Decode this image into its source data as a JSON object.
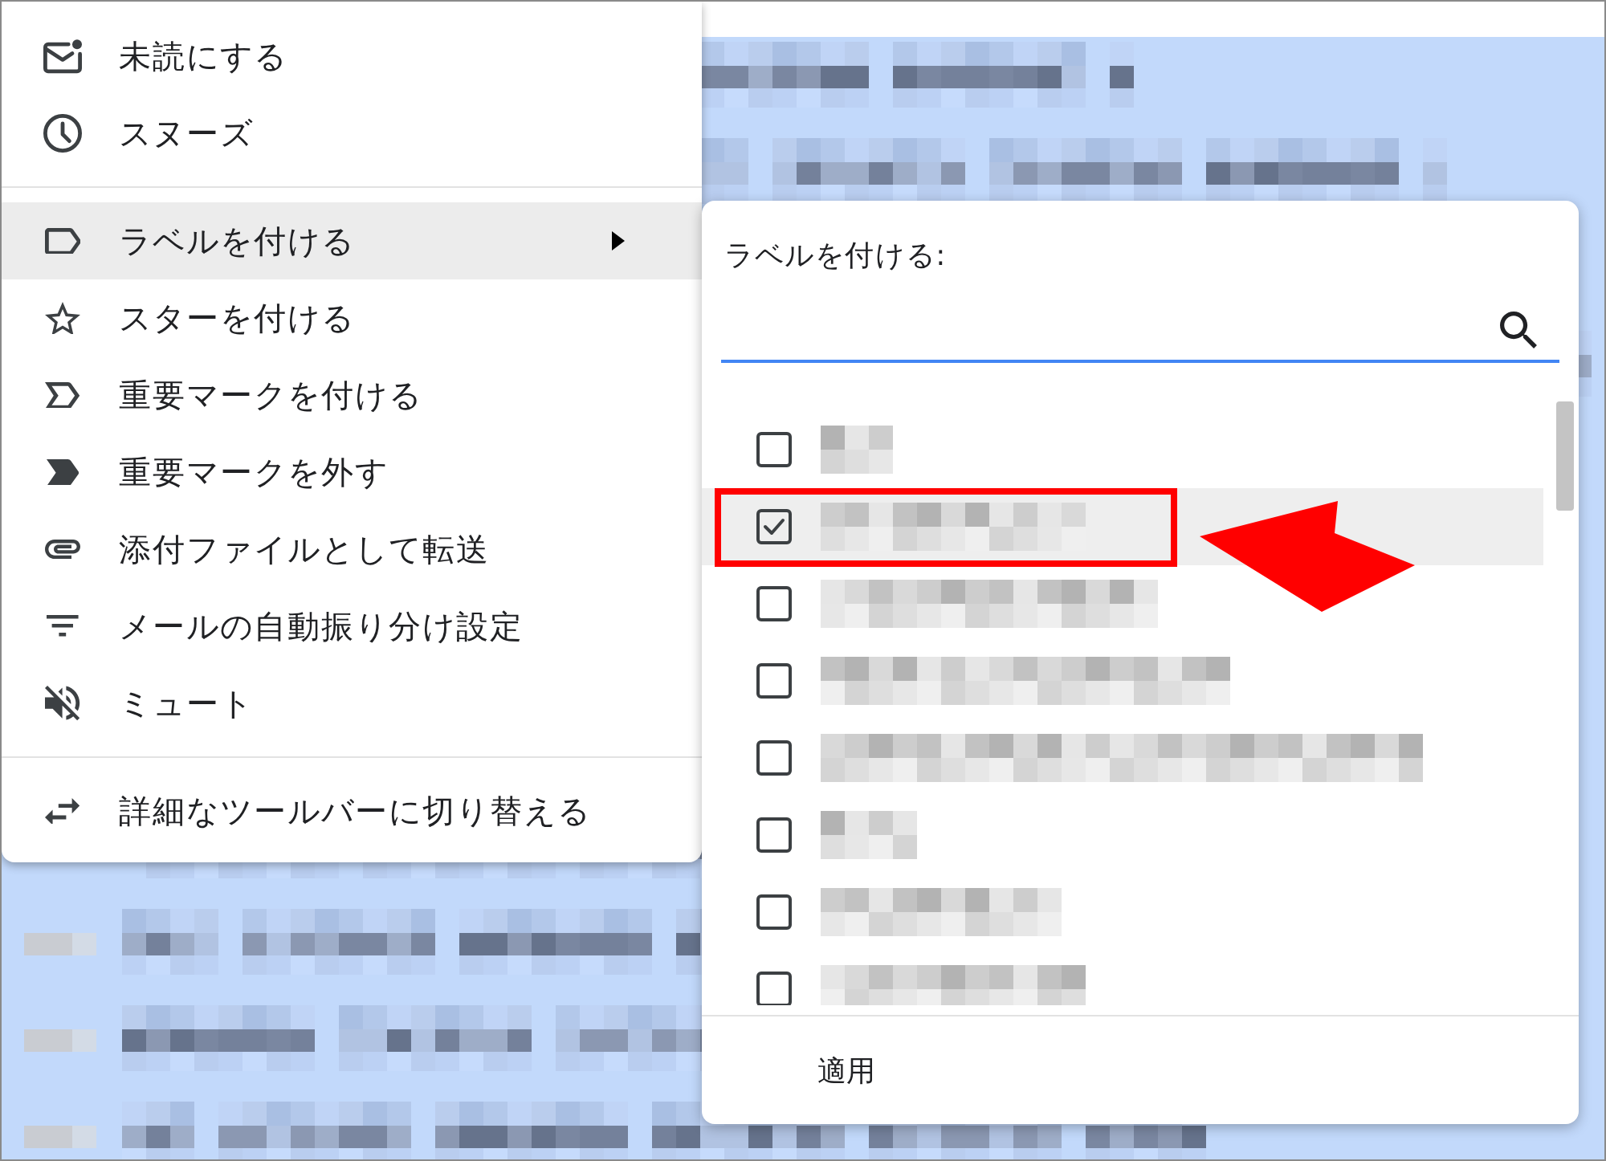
{
  "menu": {
    "groups": [
      {
        "items": [
          {
            "label": "未読にする",
            "highlighted": false,
            "has_submenu": false
          },
          {
            "label": "スヌーズ",
            "highlighted": false,
            "has_submenu": false
          }
        ]
      },
      {
        "items": [
          {
            "label": "ラベルを付ける",
            "highlighted": true,
            "has_submenu": true
          },
          {
            "label": "スターを付ける",
            "highlighted": false,
            "has_submenu": false
          },
          {
            "label": "重要マークを付ける",
            "highlighted": false,
            "has_submenu": false
          },
          {
            "label": "重要マークを外す",
            "highlighted": false,
            "has_submenu": false
          },
          {
            "label": "添付ファイルとして転送",
            "highlighted": false,
            "has_submenu": false
          },
          {
            "label": "メールの自動振り分け設定",
            "highlighted": false,
            "has_submenu": false
          },
          {
            "label": "ミュート",
            "highlighted": false,
            "has_submenu": false
          }
        ]
      },
      {
        "items": [
          {
            "label": "詳細なツールバーに切り替える",
            "highlighted": false,
            "has_submenu": false
          }
        ]
      }
    ]
  },
  "label_panel": {
    "title": "ラベルを付ける:",
    "labels": [
      {
        "checked": false,
        "highlighted": false,
        "annotated": false
      },
      {
        "checked": true,
        "highlighted": true,
        "annotated": true
      },
      {
        "checked": false,
        "highlighted": false,
        "annotated": false
      },
      {
        "checked": false,
        "highlighted": false,
        "annotated": false
      },
      {
        "checked": false,
        "highlighted": false,
        "annotated": false
      },
      {
        "checked": false,
        "highlighted": false,
        "annotated": false
      },
      {
        "checked": false,
        "highlighted": false,
        "annotated": false
      },
      {
        "checked": false,
        "highlighted": false,
        "annotated": false
      }
    ],
    "apply_button": "適用"
  }
}
